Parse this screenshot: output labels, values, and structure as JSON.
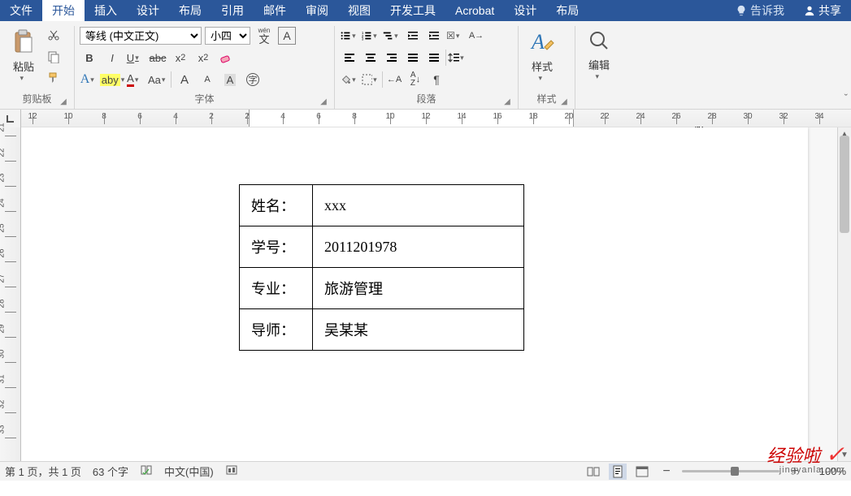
{
  "tabs": {
    "file": "文件",
    "home": "开始",
    "insert": "插入",
    "design": "设计",
    "layout": "布局",
    "references": "引用",
    "mailings": "邮件",
    "review": "审阅",
    "view": "视图",
    "devtools": "开发工具",
    "acrobat": "Acrobat",
    "design2": "设计",
    "layout2": "布局",
    "tellme": "告诉我",
    "share": "共享"
  },
  "ribbon": {
    "clipboard": {
      "paste": "粘贴",
      "label": "剪贴板"
    },
    "font": {
      "family": "等线 (中文正文)",
      "size": "小四",
      "wen_pinyin": "wén",
      "label": "字体",
      "bold": "B",
      "italic": "I",
      "underline": "U",
      "strike": "abc",
      "sub": "x₂",
      "sup": "x²",
      "texteffects": "A",
      "highlight": "aby",
      "fontcolor": "A",
      "charshade": "A",
      "aa": "Aa",
      "growA": "A",
      "shrinkA": "A",
      "zi": "字",
      "circled": "㊕"
    },
    "paragraph": {
      "label": "段落"
    },
    "styles": {
      "label": "样式",
      "btn": "样式"
    },
    "editing": {
      "label": "编辑",
      "btn": "编辑"
    }
  },
  "ruler": {
    "labels": [
      "12",
      "10",
      "8",
      "6",
      "4",
      "2",
      "2",
      "4",
      "6",
      "8",
      "10",
      "12",
      "14",
      "16",
      "18",
      "20",
      "22",
      "24",
      "26",
      "28",
      "30",
      "32",
      "34"
    ]
  },
  "vruler": {
    "labels": [
      "21",
      "22",
      "23",
      "24",
      "25",
      "26",
      "27",
      "28",
      "29",
      "30",
      "31",
      "32",
      "33"
    ]
  },
  "document": {
    "rows": [
      {
        "k": "姓名：",
        "v": "xxx"
      },
      {
        "k": "学号：",
        "v": "2011201978"
      },
      {
        "k": "专业：",
        "v": "旅游管理"
      },
      {
        "k": "导师：",
        "v": "吴某某"
      }
    ]
  },
  "status": {
    "page": "第 1 页，共 1 页",
    "words": "63 个字",
    "lang": "中文(中国)",
    "zoom": "100%"
  },
  "watermark": {
    "main": "经验啦",
    "sub": "jingyanla.com"
  }
}
